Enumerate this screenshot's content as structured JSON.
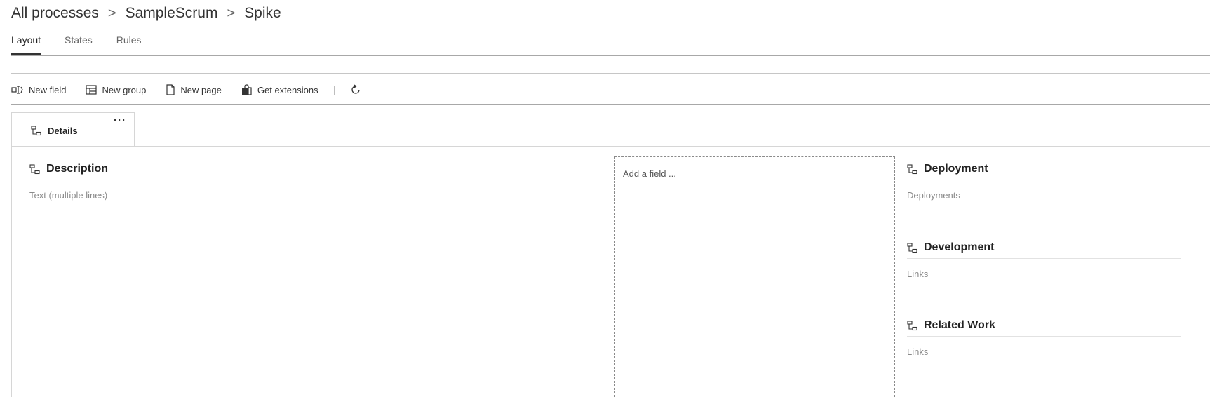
{
  "breadcrumb": {
    "items": [
      "All processes",
      "SampleScrum",
      "Spike"
    ],
    "separator": ">"
  },
  "tabs": [
    {
      "label": "Layout",
      "selected": true
    },
    {
      "label": "States",
      "selected": false
    },
    {
      "label": "Rules",
      "selected": false
    }
  ],
  "toolbar": {
    "new_field": "New field",
    "new_group": "New group",
    "new_page": "New page",
    "get_extensions": "Get extensions",
    "refresh_icon": "refresh-icon"
  },
  "page_tab": {
    "label": "Details",
    "more": "···"
  },
  "groups": {
    "description": {
      "title": "Description",
      "field": "Text (multiple lines)"
    },
    "deployment": {
      "title": "Deployment",
      "field": "Deployments"
    },
    "development": {
      "title": "Development",
      "field": "Links"
    },
    "related_work": {
      "title": "Related Work",
      "field": "Links"
    }
  },
  "drop_zone": {
    "label": "Add a field ..."
  },
  "colors": {
    "text": "#333333",
    "muted": "#8a8a8a",
    "divider": "#a8a8a8",
    "border": "#d6d6d6"
  }
}
